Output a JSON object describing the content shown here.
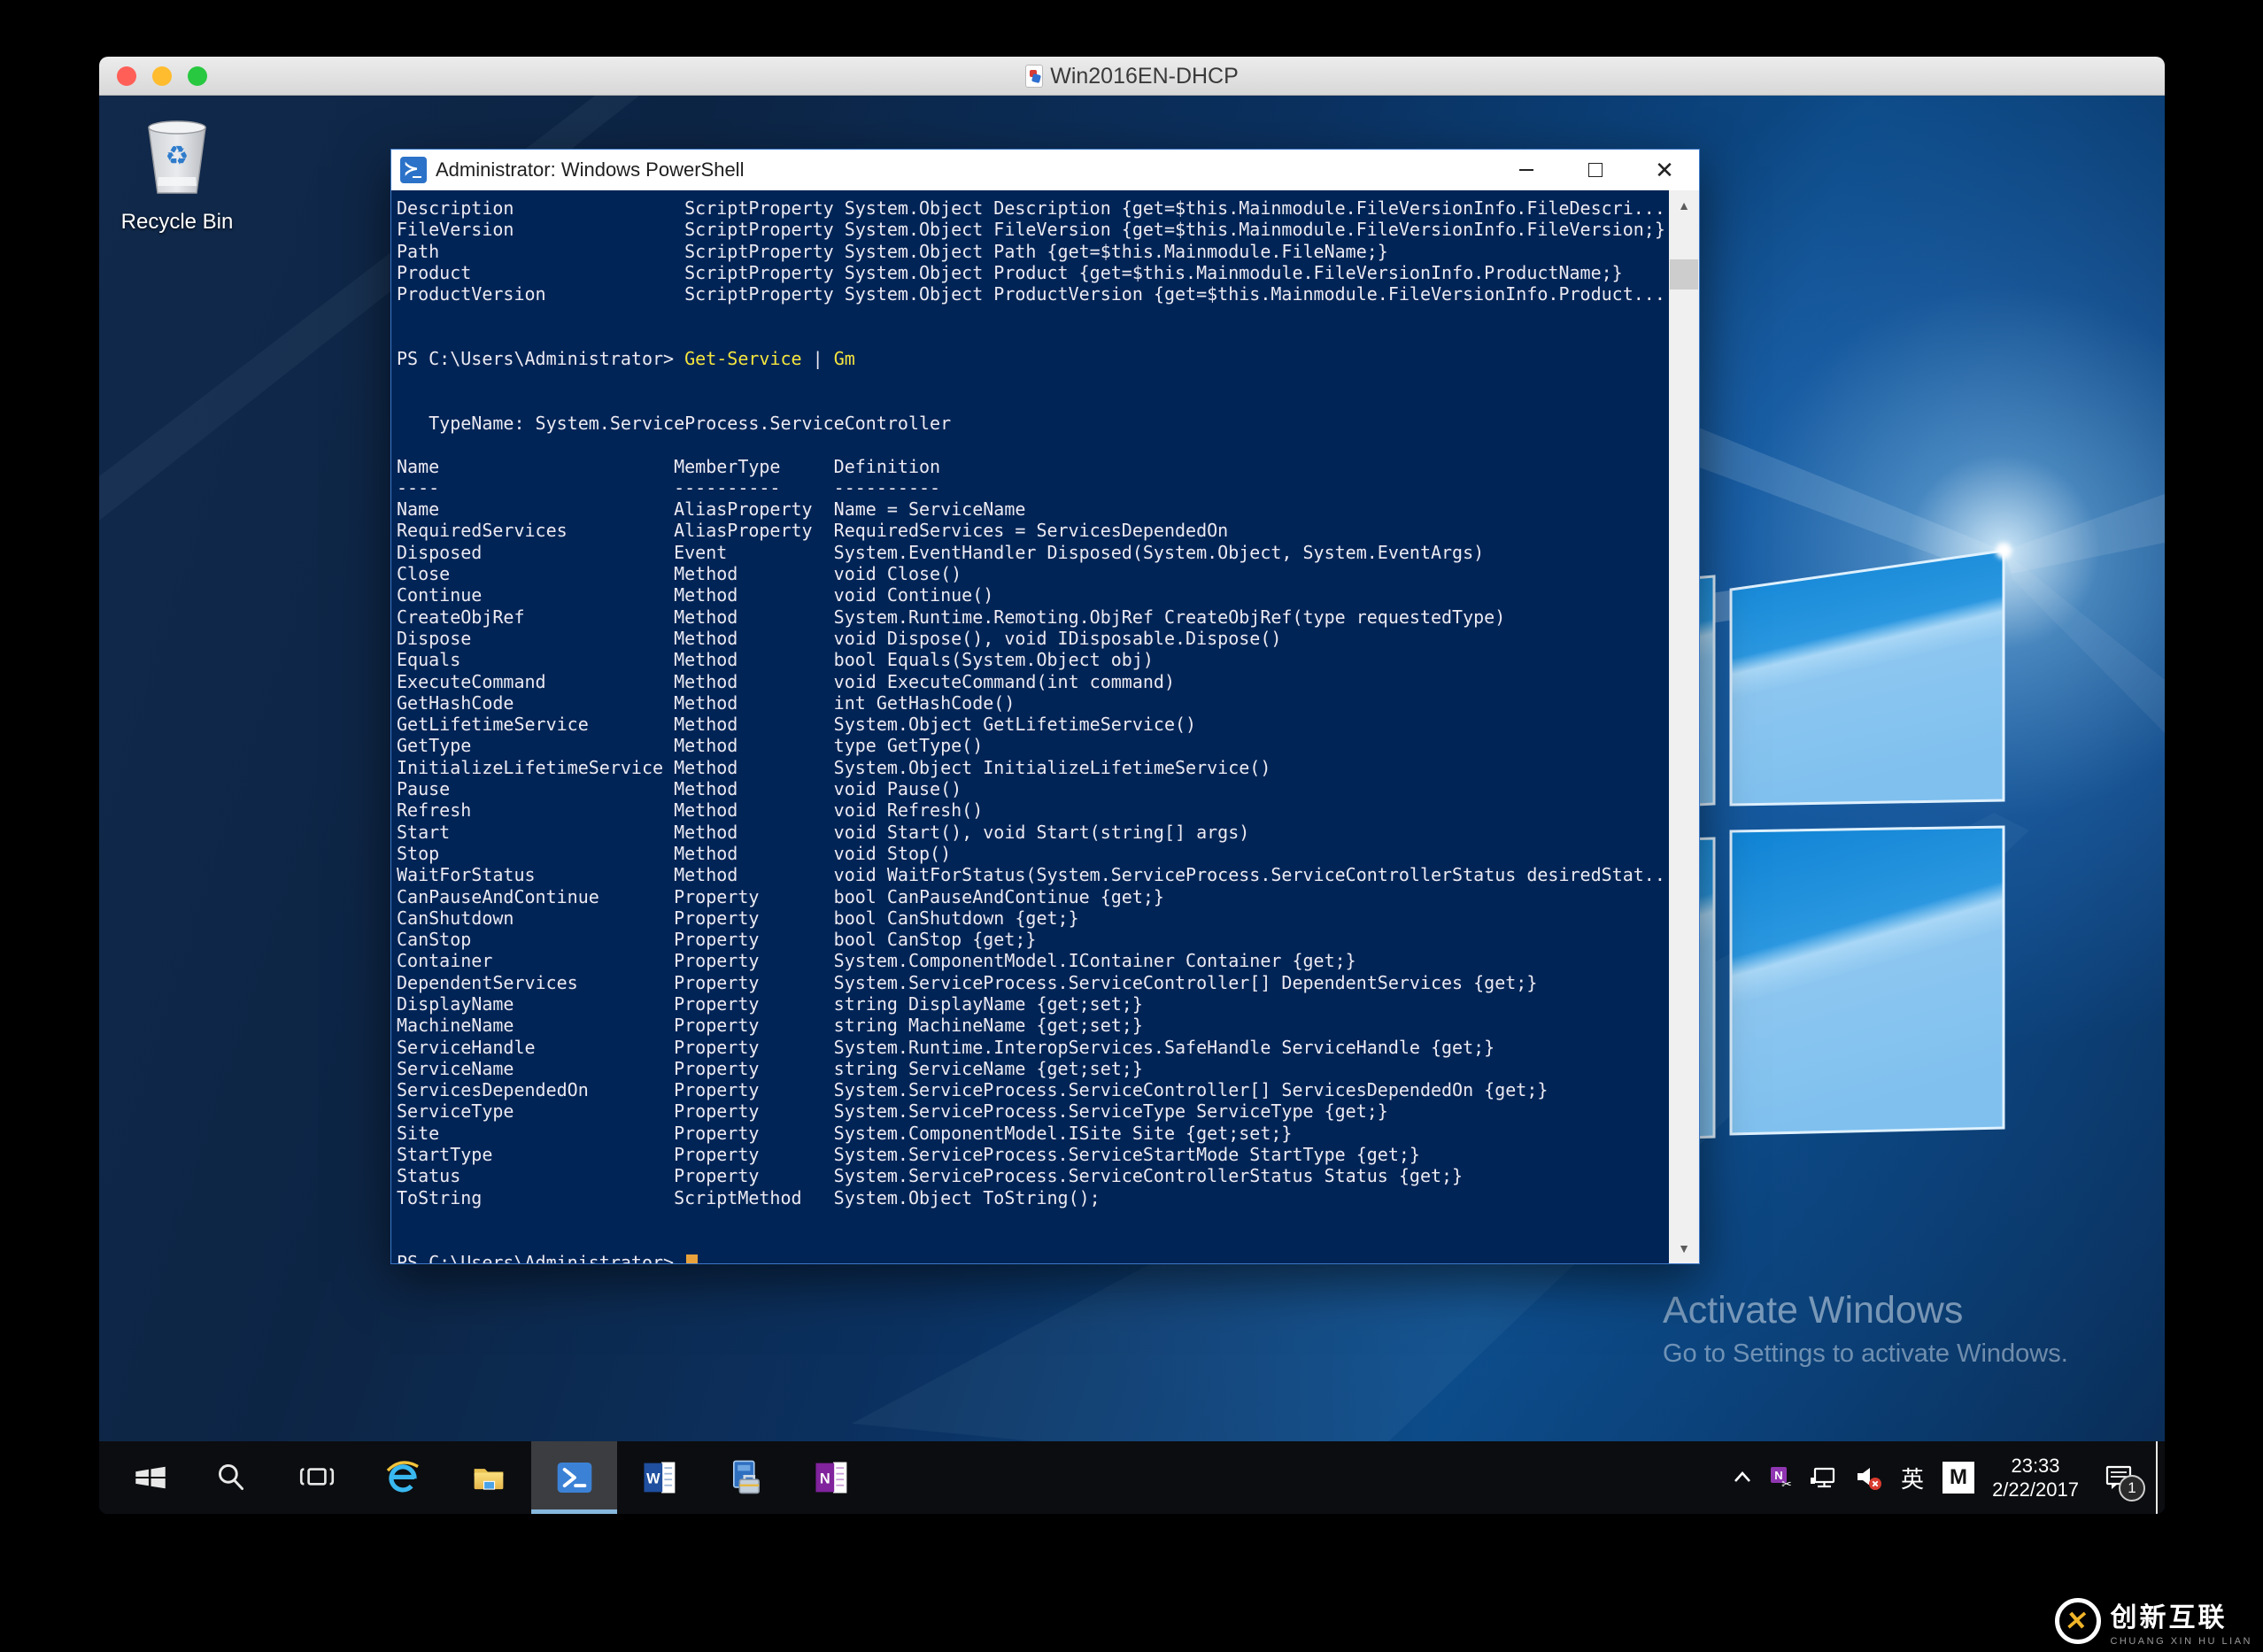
{
  "host": {
    "title": "Win2016EN-DHCP"
  },
  "desktop": {
    "recycle_bin_label": "Recycle Bin",
    "watermark": {
      "line1": "Activate Windows",
      "line2": "Go to Settings to activate Windows."
    }
  },
  "powershell": {
    "title": "Administrator: Windows PowerShell",
    "console": {
      "layout_widths": {
        "prev_name": 27,
        "name": 26,
        "membertype": 15
      },
      "prev_rows": [
        [
          "Description",
          "ScriptProperty",
          "System.Object Description {get=$this.Mainmodule.FileVersionInfo.FileDescri..."
        ],
        [
          "FileVersion",
          "ScriptProperty",
          "System.Object FileVersion {get=$this.Mainmodule.FileVersionInfo.FileVersion;}"
        ],
        [
          "Path",
          "ScriptProperty",
          "System.Object Path {get=$this.Mainmodule.FileName;}"
        ],
        [
          "Product",
          "ScriptProperty",
          "System.Object Product {get=$this.Mainmodule.FileVersionInfo.ProductName;}"
        ],
        [
          "ProductVersion",
          "ScriptProperty",
          "System.Object ProductVersion {get=$this.Mainmodule.FileVersionInfo.Product..."
        ]
      ],
      "prompt": "PS C:\\Users\\Administrator>",
      "command": {
        "cmdlet": "Get-Service",
        "pipe": "|",
        "alias": "Gm"
      },
      "typename": "TypeName: System.ServiceProcess.ServiceController",
      "table": {
        "headers": [
          "Name",
          "MemberType",
          "Definition"
        ],
        "underline": [
          "----",
          "----------",
          "----------"
        ],
        "rows": [
          [
            "Name",
            "AliasProperty",
            "Name = ServiceName"
          ],
          [
            "RequiredServices",
            "AliasProperty",
            "RequiredServices = ServicesDependedOn"
          ],
          [
            "Disposed",
            "Event",
            "System.EventHandler Disposed(System.Object, System.EventArgs)"
          ],
          [
            "Close",
            "Method",
            "void Close()"
          ],
          [
            "Continue",
            "Method",
            "void Continue()"
          ],
          [
            "CreateObjRef",
            "Method",
            "System.Runtime.Remoting.ObjRef CreateObjRef(type requestedType)"
          ],
          [
            "Dispose",
            "Method",
            "void Dispose(), void IDisposable.Dispose()"
          ],
          [
            "Equals",
            "Method",
            "bool Equals(System.Object obj)"
          ],
          [
            "ExecuteCommand",
            "Method",
            "void ExecuteCommand(int command)"
          ],
          [
            "GetHashCode",
            "Method",
            "int GetHashCode()"
          ],
          [
            "GetLifetimeService",
            "Method",
            "System.Object GetLifetimeService()"
          ],
          [
            "GetType",
            "Method",
            "type GetType()"
          ],
          [
            "InitializeLifetimeService",
            "Method",
            "System.Object InitializeLifetimeService()"
          ],
          [
            "Pause",
            "Method",
            "void Pause()"
          ],
          [
            "Refresh",
            "Method",
            "void Refresh()"
          ],
          [
            "Start",
            "Method",
            "void Start(), void Start(string[] args)"
          ],
          [
            "Stop",
            "Method",
            "void Stop()"
          ],
          [
            "WaitForStatus",
            "Method",
            "void WaitForStatus(System.ServiceProcess.ServiceControllerStatus desiredStat..."
          ],
          [
            "CanPauseAndContinue",
            "Property",
            "bool CanPauseAndContinue {get;}"
          ],
          [
            "CanShutdown",
            "Property",
            "bool CanShutdown {get;}"
          ],
          [
            "CanStop",
            "Property",
            "bool CanStop {get;}"
          ],
          [
            "Container",
            "Property",
            "System.ComponentModel.IContainer Container {get;}"
          ],
          [
            "DependentServices",
            "Property",
            "System.ServiceProcess.ServiceController[] DependentServices {get;}"
          ],
          [
            "DisplayName",
            "Property",
            "string DisplayName {get;set;}"
          ],
          [
            "MachineName",
            "Property",
            "string MachineName {get;set;}"
          ],
          [
            "ServiceHandle",
            "Property",
            "System.Runtime.InteropServices.SafeHandle ServiceHandle {get;}"
          ],
          [
            "ServiceName",
            "Property",
            "string ServiceName {get;set;}"
          ],
          [
            "ServicesDependedOn",
            "Property",
            "System.ServiceProcess.ServiceController[] ServicesDependedOn {get;}"
          ],
          [
            "ServiceType",
            "Property",
            "System.ServiceProcess.ServiceType ServiceType {get;}"
          ],
          [
            "Site",
            "Property",
            "System.ComponentModel.ISite Site {get;set;}"
          ],
          [
            "StartType",
            "Property",
            "System.ServiceProcess.ServiceStartMode StartType {get;}"
          ],
          [
            "Status",
            "Property",
            "System.ServiceProcess.ServiceControllerStatus Status {get;}"
          ],
          [
            "ToString",
            "ScriptMethod",
            "System.Object ToString();"
          ]
        ]
      }
    }
  },
  "taskbar": {
    "items": [
      "start",
      "search",
      "task-view",
      "internet-explorer",
      "file-explorer",
      "powershell",
      "word",
      "server-manager",
      "onenote"
    ],
    "active_item": "powershell"
  },
  "tray": {
    "icons": [
      "chevron-up",
      "onenote-clip",
      "network",
      "volume-muted",
      "language",
      "ime",
      "action-center"
    ],
    "language": "英",
    "ime": "M",
    "time": "23:33",
    "date": "2/22/2017",
    "notification_badge": "1"
  },
  "branding": {
    "cn": "创新互联",
    "en": "CHUANG XIN HU LIAN"
  },
  "colors": {
    "console_bg": "#012456",
    "command_yellow": "#f5e53e",
    "cursor": "#e9a23b",
    "taskbar_bg": "#0c0d10",
    "active_underline": "#86b7dd",
    "brand_yellow": "#f0b429"
  }
}
